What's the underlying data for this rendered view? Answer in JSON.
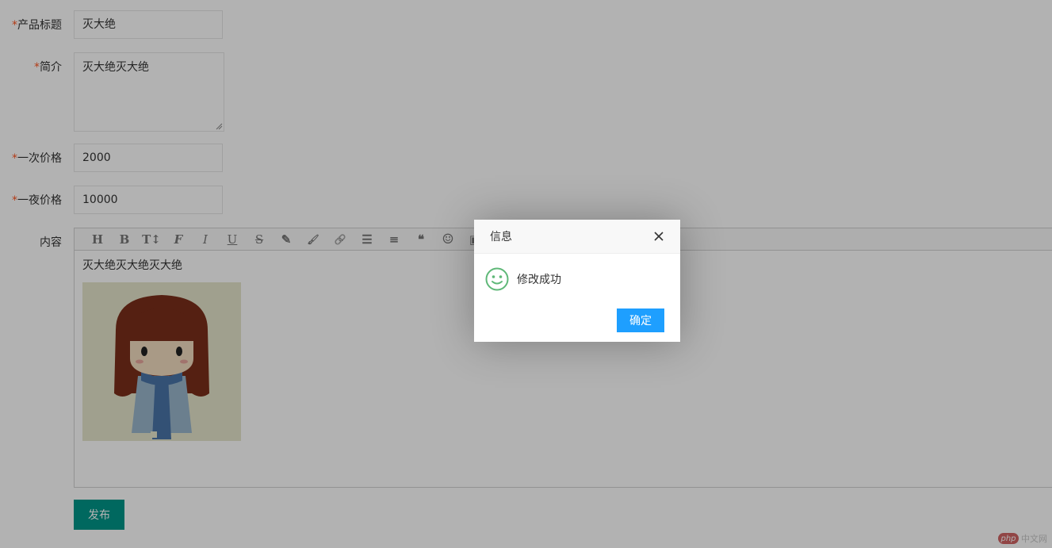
{
  "form": {
    "title_label": "产品标题",
    "title_value": "灭大绝",
    "intro_label": "简介",
    "intro_value": "灭大绝灭大绝",
    "price_once_label": "一次价格",
    "price_once_value": "2000",
    "price_night_label": "一夜价格",
    "price_night_value": "10000",
    "content_label": "内容",
    "required_mark": "*"
  },
  "editor": {
    "toolbar_icons": [
      "heading-icon",
      "bold-icon",
      "font-size-icon",
      "font-family-icon",
      "italic-icon",
      "underline-icon",
      "strikethrough-icon",
      "highlight-icon",
      "brush-icon",
      "link-icon",
      "list-icon",
      "align-icon",
      "quote-icon",
      "emoji-icon",
      "image-icon"
    ],
    "toolbar_glyphs": [
      "H",
      "B",
      "T↕",
      "F",
      "I",
      "U",
      "S",
      "✎",
      "🖌",
      "🔗",
      "☰",
      "≡",
      "❝",
      "☺",
      "▣"
    ],
    "content_text": "灭大绝灭大绝灭大绝"
  },
  "publish_label": "发布",
  "dialog": {
    "title": "信息",
    "message": "修改成功",
    "ok_label": "确定"
  },
  "watermark": {
    "logo_text": "php",
    "site_text": "中文网"
  },
  "colors": {
    "required": "#ff5722",
    "publish": "#009688",
    "ok": "#1e9fff",
    "smile": "#5fb878"
  }
}
